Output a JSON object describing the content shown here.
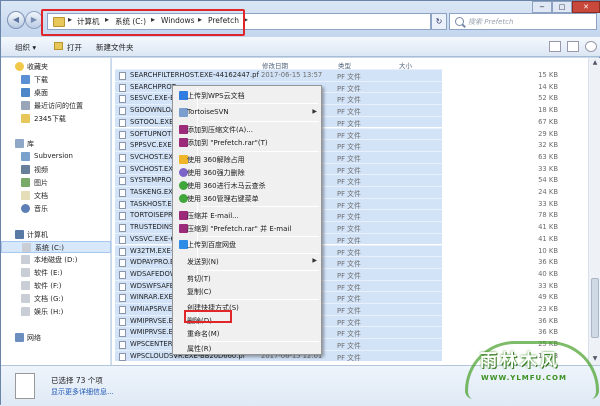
{
  "address": {
    "crumbs": [
      "计算机",
      "系统 (C:)",
      "Windows",
      "Prefetch"
    ],
    "separator": "▸",
    "refresh_icon": "↻"
  },
  "search": {
    "placeholder": "搜索 Prefetch"
  },
  "window_controls": {
    "min": "−",
    "max": "□",
    "close": "✕"
  },
  "nav_buttons": {
    "back": "◀",
    "forward": "▶"
  },
  "toolbar": {
    "organize": "组织 ▾",
    "open": "打开",
    "new_folder": "新建文件夹"
  },
  "nav": {
    "favorites": "收藏夹",
    "downloads": "下载",
    "desktop": "桌面",
    "recent": "最近访问的位置",
    "downloads2345": "2345下载",
    "library": "库",
    "subversion": "Subversion",
    "videos": "视频",
    "pictures": "图片",
    "documents": "文档",
    "music": "音乐",
    "computer": "计算机",
    "drive_c": "系统 (C:)",
    "drive_d": "本地磁盘 (D:)",
    "drive_e": "软件 (E:)",
    "drive_f": "软件 (F:)",
    "drive_g": "文档 (G:)",
    "drive_h": "娱乐 (H:)",
    "network": "网络"
  },
  "columns": {
    "date": "修改日期",
    "type": "类型",
    "size": "大小"
  },
  "files": [
    {
      "name": "SEARCHFILTERHOST.EXE-44162447.pf",
      "date": "2017-06-15 13:57",
      "type": "PF 文件",
      "size": "15 KB"
    },
    {
      "name": "SEARCHPROT",
      "date": "",
      "type": "PF 文件",
      "size": "14 KB"
    },
    {
      "name": "SESVC.EXE-E0",
      "date": "",
      "type": "PF 文件",
      "size": "52 KB"
    },
    {
      "name": "SGDOWNLOA",
      "date": "",
      "type": "PF 文件",
      "size": "18 KB"
    },
    {
      "name": "SGTOOL.EXE",
      "date": "",
      "type": "PF 文件",
      "size": "67 KB"
    },
    {
      "name": "SOFTUPNOTI",
      "date": "",
      "type": "PF 文件",
      "size": "29 KB"
    },
    {
      "name": "SPPSVC.EXE-9",
      "date": "",
      "type": "PF 文件",
      "size": "32 KB"
    },
    {
      "name": "SVCHOST.EXE",
      "date": "",
      "type": "PF 文件",
      "size": "63 KB"
    },
    {
      "name": "SVCHOST.EXE",
      "date": "",
      "type": "PF 文件",
      "size": "33 KB"
    },
    {
      "name": "SYSTEMPROP",
      "date": "",
      "type": "PF 文件",
      "size": "54 KB"
    },
    {
      "name": "TASKENG.EX",
      "date": "",
      "type": "PF 文件",
      "size": "24 KB"
    },
    {
      "name": "TASKHOST.EX",
      "date": "",
      "type": "PF 文件",
      "size": "33 KB"
    },
    {
      "name": "TORTOISEPRO",
      "date": "",
      "type": "PF 文件",
      "size": "78 KB"
    },
    {
      "name": "TRUSTEDINST",
      "date": "",
      "type": "PF 文件",
      "size": "41 KB"
    },
    {
      "name": "VSSVC.EXE-6C",
      "date": "",
      "type": "PF 文件",
      "size": "41 KB"
    },
    {
      "name": "W32TM.EXE-C",
      "date": "",
      "type": "PF 文件",
      "size": "10 KB"
    },
    {
      "name": "WDPAYPRO.EX",
      "date": "",
      "type": "PF 文件",
      "size": "36 KB"
    },
    {
      "name": "WDSAFEDOWI",
      "date": "",
      "type": "PF 文件",
      "size": "40 KB"
    },
    {
      "name": "WDSWFSAFE.E",
      "date": "",
      "type": "PF 文件",
      "size": "33 KB"
    },
    {
      "name": "WINRAR.EXE-",
      "date": "",
      "type": "PF 文件",
      "size": "49 KB"
    },
    {
      "name": "WMIAPSRV.EX",
      "date": "",
      "type": "PF 文件",
      "size": "23 KB"
    },
    {
      "name": "WMIPRVSE.EX",
      "date": "",
      "type": "PF 文件",
      "size": "36 KB"
    },
    {
      "name": "WMIPRVSE.EX",
      "date": "",
      "type": "PF 文件",
      "size": "36 KB"
    },
    {
      "name": "WPSCENTER.E",
      "date": "",
      "type": "PF 文件",
      "size": "25 KB"
    },
    {
      "name": "WPSCLOUDSVR.EXE-BB20D660.pf",
      "date": "2017-06-15 12:01",
      "type": "PF 文件",
      "size": "16 KB"
    }
  ],
  "context_menu": {
    "upload_wps": "上传到WPS云文档",
    "tortoisesvn": "TortoiseSVN",
    "add_archive": "添加到压缩文件(A)...",
    "add_prefetch_rar": "添加到 \"Prefetch.rar\"(T)",
    "unlock_360": "使用 360解除占用",
    "force_delete_360": "使用 360强力删除",
    "scan_360": "使用 360进行木马云查杀",
    "manage_menu_360": "使用 360管理右键菜单",
    "compress_email": "压缩并 E-mail...",
    "compress_rar_email": "压缩到 \"Prefetch.rar\" 并 E-mail",
    "upload_baidu": "上传到百度网盘",
    "send_to": "发送到(N)",
    "cut": "剪切(T)",
    "copy": "复制(C)",
    "create_shortcut": "创建快捷方式(S)",
    "delete": "删除(D)",
    "rename": "重命名(M)",
    "properties": "属性(R)",
    "submenu_arrow": "▶"
  },
  "details": {
    "selected": "已选择 73 个项",
    "show_more": "显示更多详细信息..."
  },
  "watermark": {
    "title": "雨林木风",
    "url": "WWW.YLMFU.COM"
  },
  "colors": {
    "selection": "#d2e3f8",
    "highlight_box": "#e0262a",
    "title_bar": "#c3d6ee"
  }
}
